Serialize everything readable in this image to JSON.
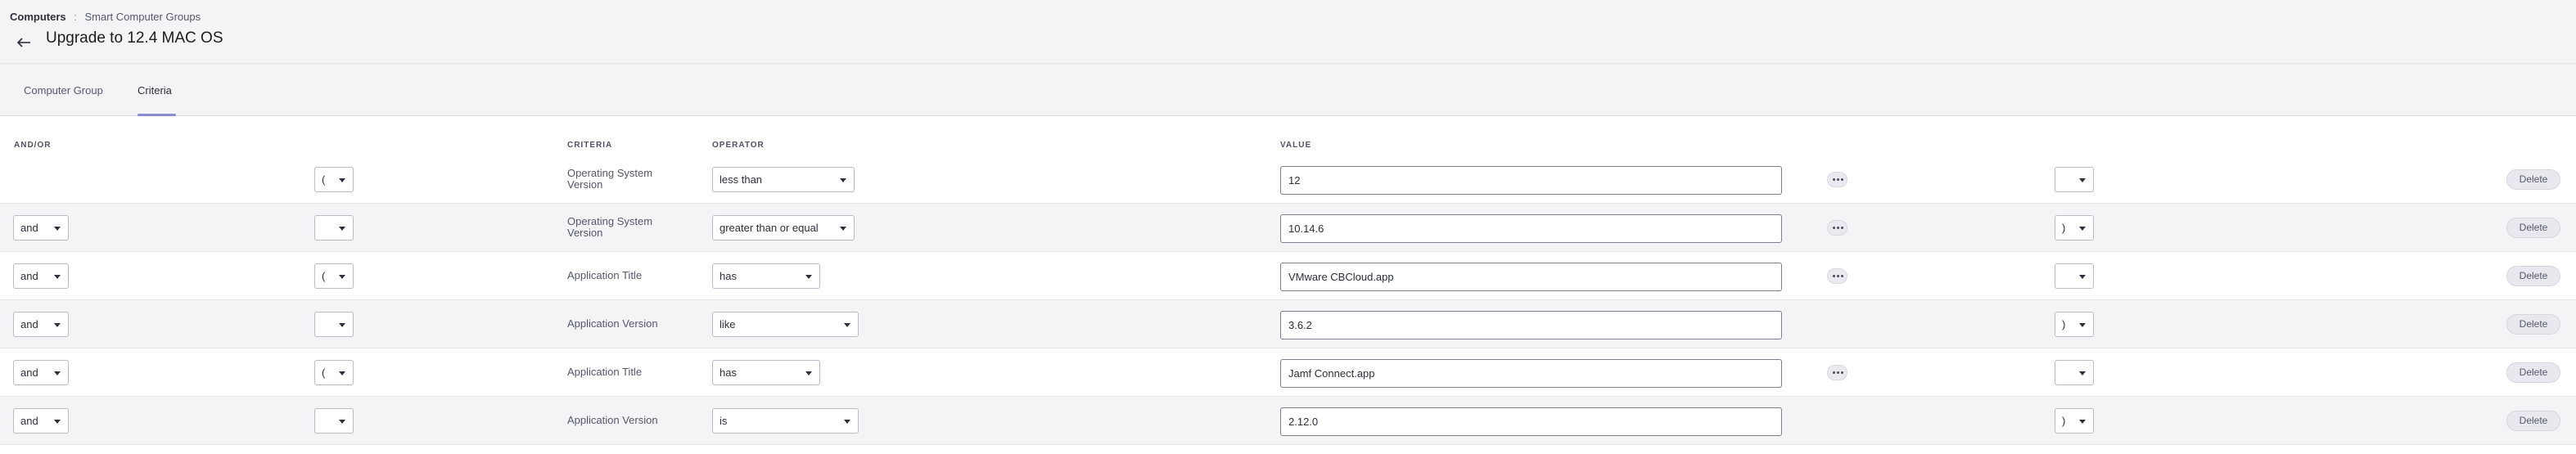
{
  "breadcrumb": {
    "root": "Computers",
    "separator": ":",
    "current": "Smart Computer Groups"
  },
  "page_title": "Upgrade to 12.4 MAC OS",
  "tabs": [
    {
      "label": "Computer Group",
      "active": false
    },
    {
      "label": "Criteria",
      "active": true
    }
  ],
  "columns": {
    "and_or": "AND/OR",
    "criteria": "CRITERIA",
    "operator": "OPERATOR",
    "value": "VALUE"
  },
  "rows": [
    {
      "and_or": "",
      "open_paren": "(",
      "criteria": "Operating System Version",
      "operator": "less than",
      "value": "12",
      "has_more": true,
      "close_paren": "",
      "delete": "Delete"
    },
    {
      "and_or": "and",
      "open_paren": "",
      "criteria": "Operating System Version",
      "operator": "greater than or equal",
      "value": "10.14.6",
      "has_more": true,
      "close_paren": ")",
      "delete": "Delete"
    },
    {
      "and_or": "and",
      "open_paren": "(",
      "criteria": "Application Title",
      "operator": "has",
      "value": "VMware CBCloud.app",
      "has_more": true,
      "close_paren": "",
      "delete": "Delete"
    },
    {
      "and_or": "and",
      "open_paren": "",
      "criteria": "Application Version",
      "operator": "like",
      "value": "3.6.2",
      "has_more": false,
      "close_paren": ")",
      "delete": "Delete"
    },
    {
      "and_or": "and",
      "open_paren": "(",
      "criteria": "Application Title",
      "operator": "has",
      "value": "Jamf Connect.app",
      "has_more": true,
      "close_paren": "",
      "delete": "Delete"
    },
    {
      "and_or": "and",
      "open_paren": "",
      "criteria": "Application Version",
      "operator": "is",
      "value": "2.12.0",
      "has_more": false,
      "close_paren": ")",
      "delete": "Delete"
    }
  ],
  "icons": {
    "back": "arrow-left-icon",
    "dropdown": "chevron-down-icon",
    "more": "ellipsis-icon"
  },
  "colors": {
    "accent": "#8d8bd3",
    "header_bg": "#f4f4f7",
    "row_shade": "#f4f4f7"
  }
}
